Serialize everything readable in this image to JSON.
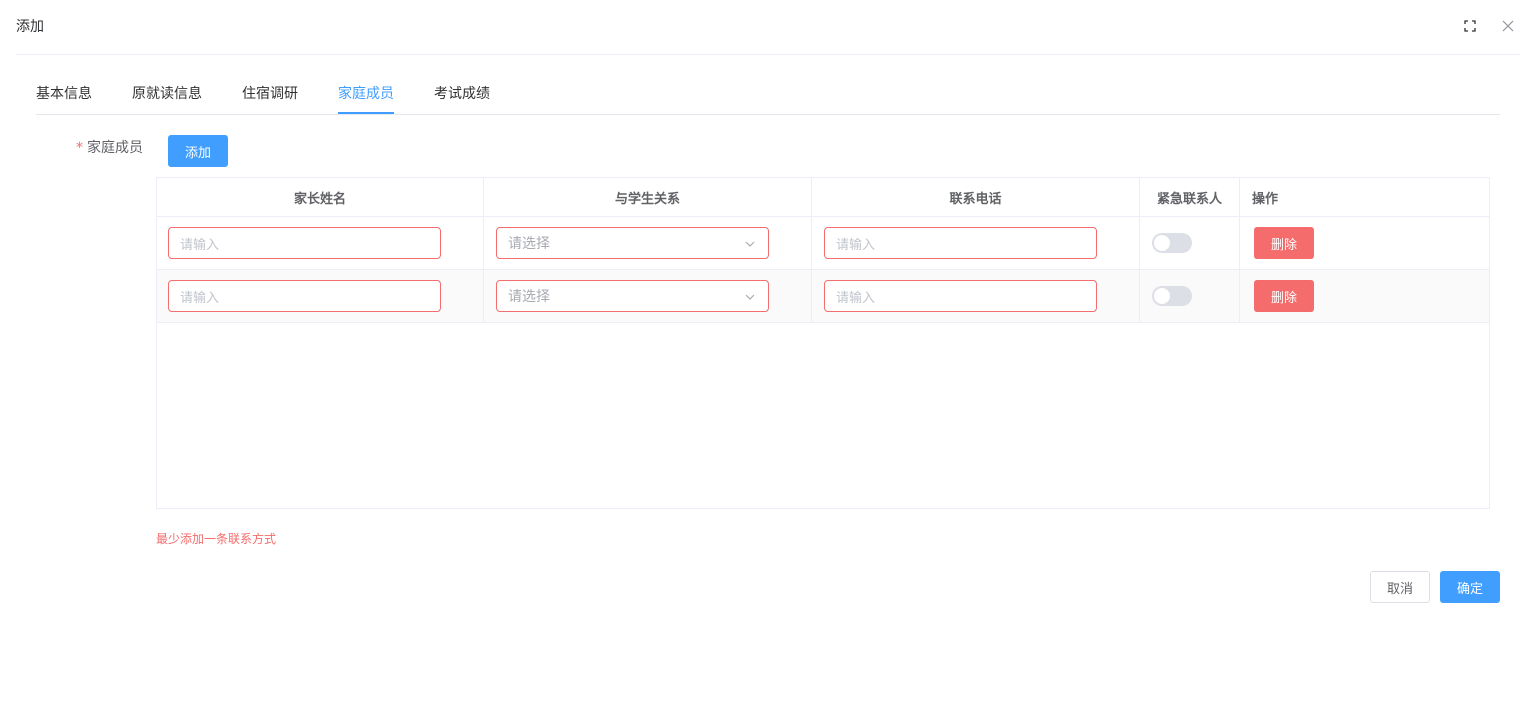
{
  "dialog": {
    "title": "添加",
    "icons": {
      "fullscreen": "fullscreen-icon",
      "close": "close-icon"
    }
  },
  "tabs": [
    {
      "label": "基本信息",
      "active": false
    },
    {
      "label": "原就读信息",
      "active": false
    },
    {
      "label": "住宿调研",
      "active": false
    },
    {
      "label": "家庭成员",
      "active": true
    },
    {
      "label": "考试成绩",
      "active": false
    }
  ],
  "form": {
    "required_mark": "*",
    "label": "家庭成员",
    "add_button": "添加"
  },
  "table": {
    "columns": [
      "家长姓名",
      "与学生关系",
      "联系电话",
      "紧急联系人",
      "操作"
    ],
    "rows": [
      {
        "name_placeholder": "请输入",
        "relation_placeholder": "请选择",
        "phone_placeholder": "请输入",
        "emergency": false,
        "delete_label": "删除"
      },
      {
        "name_placeholder": "请输入",
        "relation_placeholder": "请选择",
        "phone_placeholder": "请输入",
        "emergency": false,
        "delete_label": "删除"
      }
    ]
  },
  "validation": {
    "error": "最少添加一条联系方式"
  },
  "footer": {
    "cancel": "取消",
    "confirm": "确定"
  },
  "colors": {
    "primary": "#409eff",
    "danger": "#f56c6c",
    "border": "#ebeef5"
  }
}
